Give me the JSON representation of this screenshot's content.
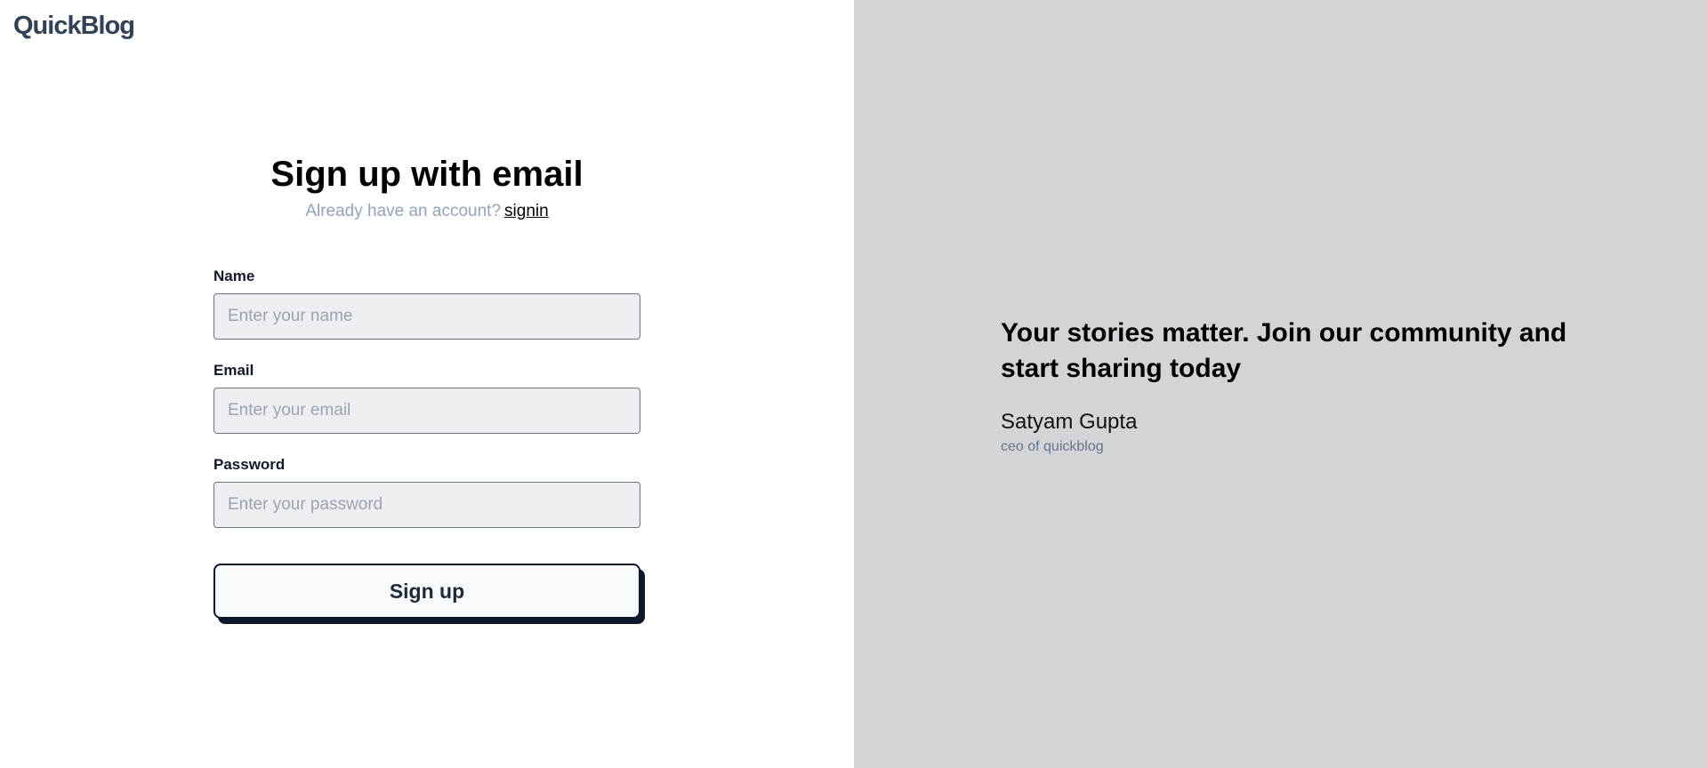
{
  "brand": {
    "logo_text": "QuickBlog"
  },
  "signup": {
    "title": "Sign up with email",
    "account_prompt": "Already have an account?",
    "signin_link": "signin",
    "fields": [
      {
        "label": "Name",
        "placeholder": "Enter your name",
        "value": ""
      },
      {
        "label": "Email",
        "placeholder": "Enter your email",
        "value": ""
      },
      {
        "label": "Password",
        "placeholder": "Enter your password",
        "value": ""
      }
    ],
    "submit_label": "Sign up"
  },
  "testimonial": {
    "quote": "Your stories matter. Join our community and start sharing today",
    "author": "Satyam Gupta",
    "role": "ceo of quickblog"
  },
  "colors": {
    "panel_background": "#d4d4d8",
    "input_background": "#eceef2",
    "button_shadow": "#0f172a",
    "muted_text": "#94a3b8"
  }
}
